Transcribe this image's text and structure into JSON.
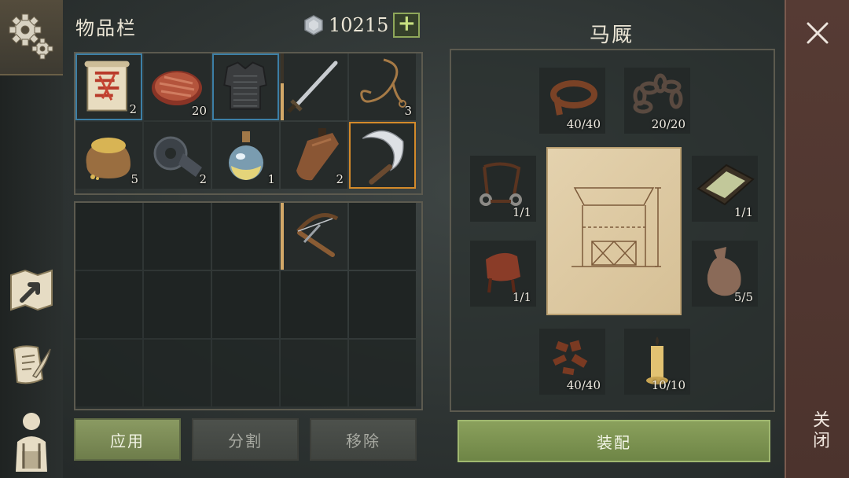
{
  "inventory": {
    "title": "物品栏",
    "currency": "10215",
    "plus_label": "+",
    "items": [
      {
        "name": "scroll-map",
        "count": "2",
        "selected": "blue"
      },
      {
        "name": "raw-meat",
        "count": "20"
      },
      {
        "name": "chainmail-armor",
        "count": "",
        "selected": "blue"
      },
      {
        "name": "sword",
        "count": "",
        "durability": 0.55
      },
      {
        "name": "rope",
        "count": "3"
      },
      {
        "name": "grain-sack",
        "count": "5"
      },
      {
        "name": "gear",
        "count": "2"
      },
      {
        "name": "potion-flask",
        "count": "1"
      },
      {
        "name": "leather-flask",
        "count": "2"
      },
      {
        "name": "sickle",
        "count": "",
        "selected": "orange"
      }
    ],
    "storage_items": [
      {
        "index": 3,
        "name": "crossbow",
        "durability": 1.0
      }
    ],
    "buttons": {
      "apply": "应用",
      "split": "分割",
      "remove": "移除"
    }
  },
  "stable": {
    "title": "马厩",
    "slots": [
      {
        "name": "leather-straps",
        "count": "40/40"
      },
      {
        "name": "iron-chain",
        "count": "20/20"
      },
      {
        "name": "bridle",
        "count": "1/1"
      },
      {
        "name": "trough",
        "count": "1/1"
      },
      {
        "name": "saddle",
        "count": "1/1"
      },
      {
        "name": "feed-bag",
        "count": "5/5"
      },
      {
        "name": "leather-scraps",
        "count": "40/40"
      },
      {
        "name": "candle",
        "count": "10/10"
      }
    ],
    "equip_label": "装配"
  },
  "close": {
    "label": "关闭",
    "icon": "close-x-icon"
  }
}
